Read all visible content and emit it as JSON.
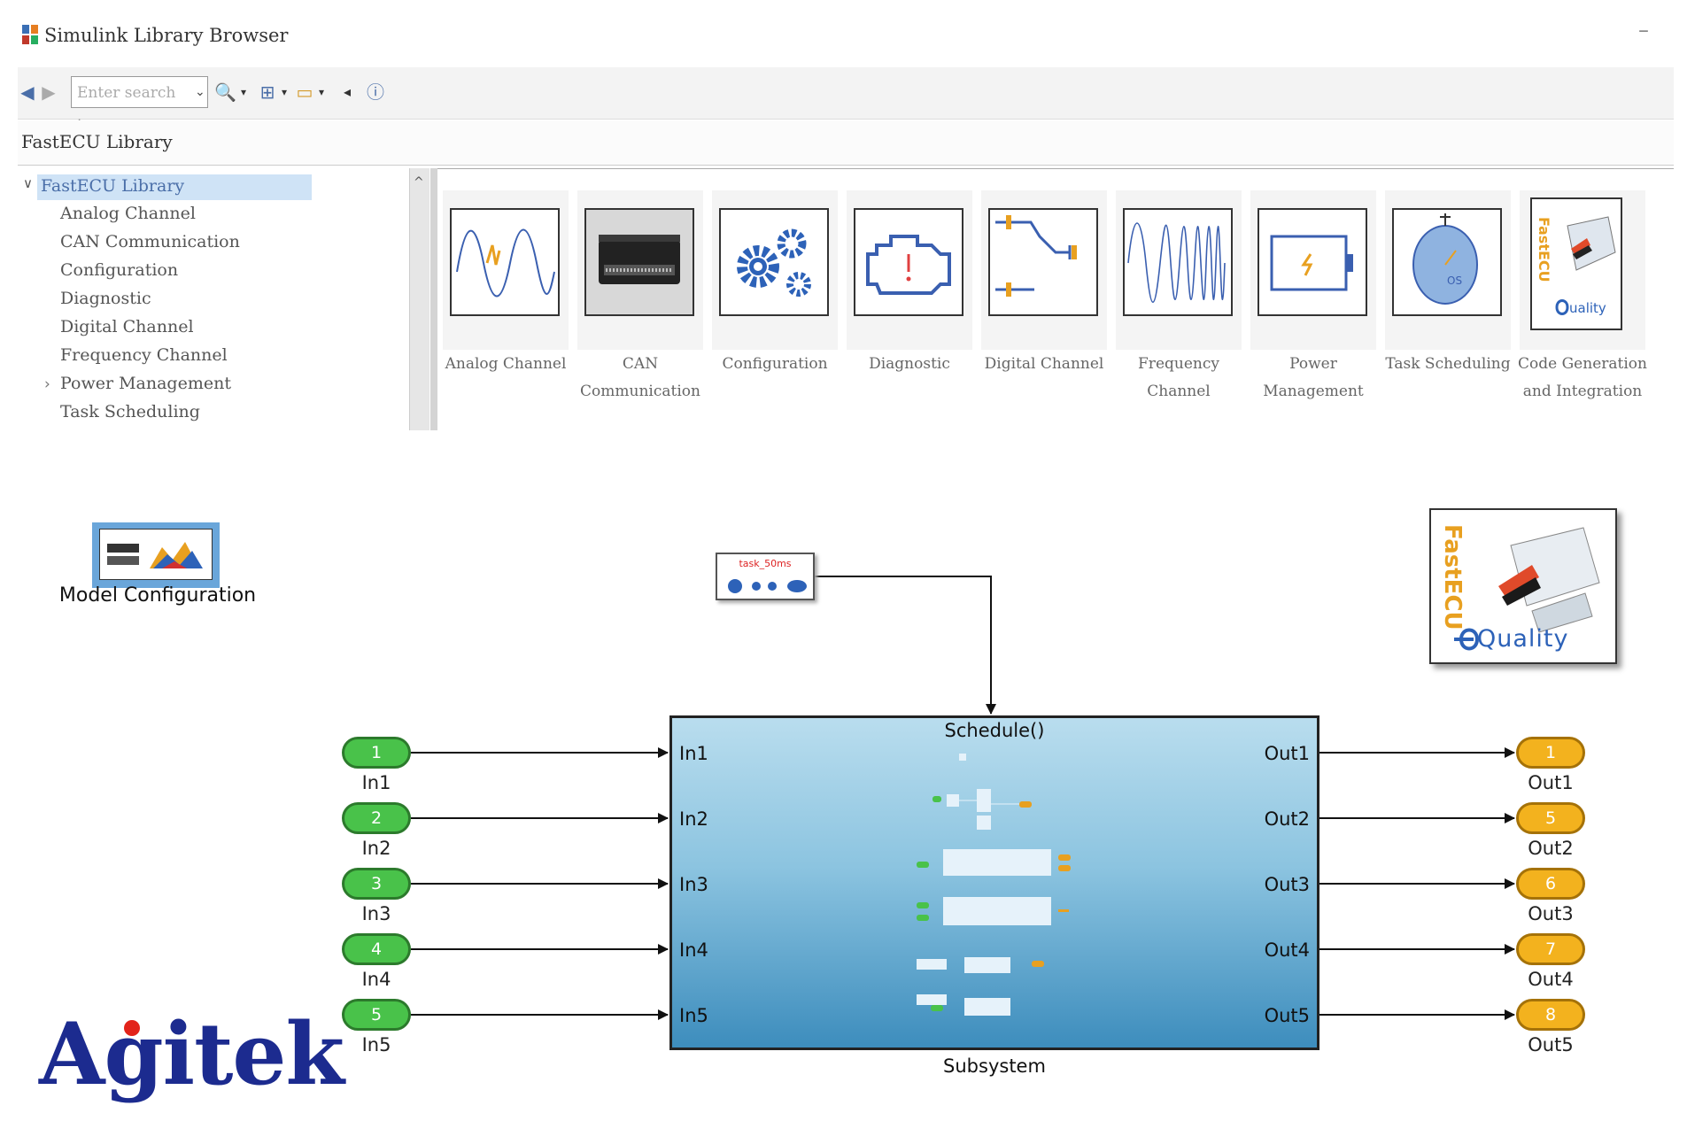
{
  "window": {
    "title": "Simulink Library Browser",
    "minimize": "–"
  },
  "toolbar": {
    "search_placeholder": "Enter search term"
  },
  "library_bar": {
    "label": "FastECU Library"
  },
  "tree": {
    "root": "FastECU Library",
    "items": [
      {
        "label": "Analog Channel"
      },
      {
        "label": "CAN Communication"
      },
      {
        "label": "Configuration"
      },
      {
        "label": "Diagnostic"
      },
      {
        "label": "Digital Channel"
      },
      {
        "label": "Frequency Channel"
      },
      {
        "label": "Power Management",
        "expandable": true
      },
      {
        "label": "Task Scheduling"
      }
    ]
  },
  "tiles": [
    {
      "label": "Analog Channel",
      "icon": "sine-wave-icon"
    },
    {
      "label": "CAN Communication",
      "icon": "ecu-hardware-icon"
    },
    {
      "label": "Configuration",
      "icon": "gears-icon"
    },
    {
      "label": "Diagnostic",
      "icon": "engine-warning-icon"
    },
    {
      "label": "Digital Channel",
      "icon": "digital-signal-icon"
    },
    {
      "label": "Frequency Channel",
      "icon": "chirp-wave-icon"
    },
    {
      "label": "Power Management",
      "icon": "battery-icon"
    },
    {
      "label": "Task Scheduling",
      "icon": "os-clock-icon"
    },
    {
      "label": "Code Generation and Integration",
      "icon": "fastecu-logo-icon"
    }
  ],
  "model": {
    "model_config_label": "Model Configuration",
    "task_label": "task_50ms",
    "fastecu": {
      "brand": "FastECU",
      "tagline": "Quality"
    },
    "subsystem": {
      "title": "Schedule()",
      "name": "Subsystem",
      "inputs": [
        "In1",
        "In2",
        "In3",
        "In4",
        "In5"
      ],
      "outputs": [
        "Out1",
        "Out2",
        "Out3",
        "Out4",
        "Out5"
      ]
    },
    "inports": [
      {
        "number": "1",
        "name": "In1"
      },
      {
        "number": "2",
        "name": "In2"
      },
      {
        "number": "3",
        "name": "In3"
      },
      {
        "number": "4",
        "name": "In4"
      },
      {
        "number": "5",
        "name": "In5"
      }
    ],
    "outports": [
      {
        "number": "1",
        "name": "Out1"
      },
      {
        "number": "5",
        "name": "Out2"
      },
      {
        "number": "6",
        "name": "Out3"
      },
      {
        "number": "7",
        "name": "Out4"
      },
      {
        "number": "8",
        "name": "Out5"
      }
    ]
  },
  "brand_logo": "Agitek",
  "colors": {
    "inport": "#49c24a",
    "outport": "#f3b21e",
    "selection": "#cfe3f6",
    "agitek_blue": "#1c2b8f",
    "accent_red": "#e2231a"
  }
}
